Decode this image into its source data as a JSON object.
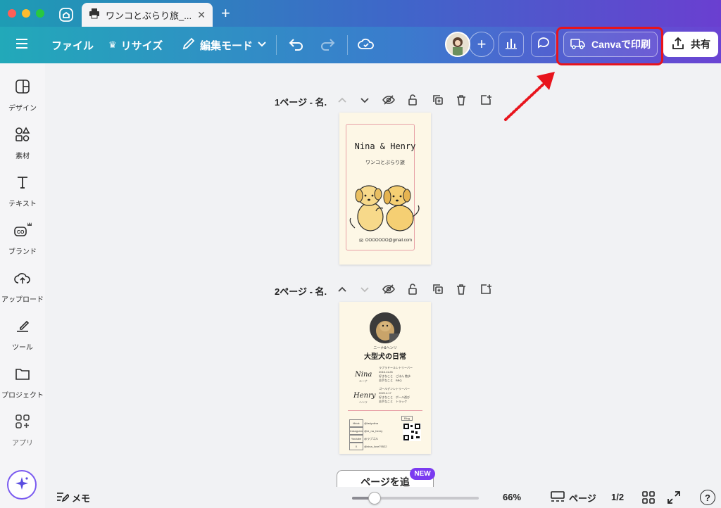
{
  "tab": {
    "title": "ワンコとぶらり旅_...",
    "close": "✕",
    "new_tab": "+"
  },
  "toolbar": {
    "file": "ファイル",
    "resize": "リサイズ",
    "edit_mode": "編集モード",
    "print": "Canvaで印刷",
    "share": "共有"
  },
  "sidebar": {
    "items": [
      {
        "label": "デザイン"
      },
      {
        "label": "素材"
      },
      {
        "label": "テキスト"
      },
      {
        "label": "ブランド"
      },
      {
        "label": "アップロード"
      },
      {
        "label": "ツール"
      },
      {
        "label": "プロジェクト"
      },
      {
        "label": "アプリ"
      }
    ]
  },
  "pages": [
    {
      "title": "1ページ - 名."
    },
    {
      "title": "2ページ - 名."
    }
  ],
  "card1": {
    "name": "Nina & Henry",
    "subtitle": "ワンコとぶらり旅",
    "email": "OOOOOOO@gmail.com"
  },
  "card2": {
    "kana": "ニーナ&ヘンリ",
    "title": "大型犬の日常",
    "nina_name": "Nina",
    "nina_kana": "ニーナ",
    "nina_breed": "ラブラドールレトリーバー",
    "nina_birth": "2016.11.26",
    "nina_likes": "好きなこと　ごはん 散歩",
    "nina_weak": "苦手なこと　BBQ",
    "henry_name": "Henry",
    "henry_kana": "ヘンリ",
    "henry_breed": "ゴールデンレトリーバー",
    "henry_birth": "2020.4.17",
    "henry_likes": "好きなこと　ボール遊び",
    "henry_weak": "苦手なこと　トラック",
    "blog": "Blog",
    "social": [
      {
        "k": "tiktok",
        "v": "@ladyniina"
      },
      {
        "k": "Instagram",
        "v": "@ni_na_henry"
      },
      {
        "k": "Youtube",
        "v": "@ラブゴル"
      },
      {
        "k": "X",
        "v": "@nina_love79522"
      }
    ]
  },
  "add_page": "ページを追",
  "new_badge": "NEW",
  "bottom": {
    "notes": "メモ",
    "zoom": "66%",
    "pages": "ページ",
    "page_count": "1/2",
    "help": "?",
    "zoom_fraction": 0.18
  }
}
